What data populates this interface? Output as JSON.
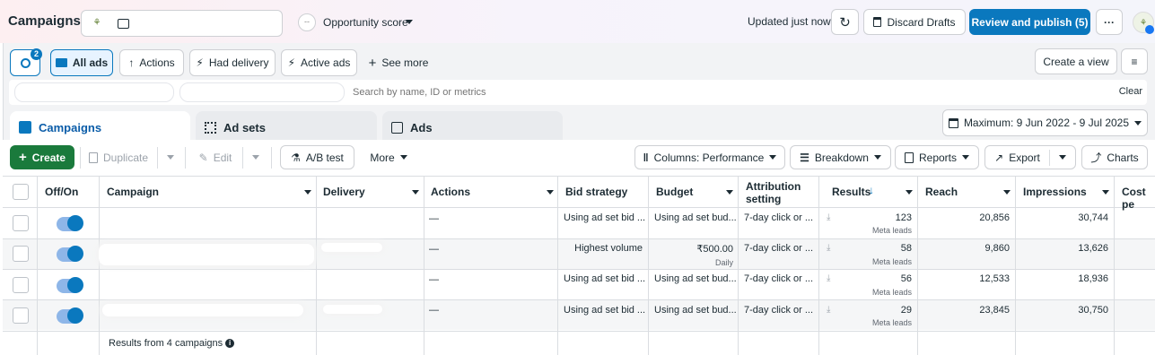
{
  "header": {
    "title": "Campaigns",
    "opportunity_label": "Opportunity score",
    "opportunity_dot": "--",
    "updated_text": "Updated just now",
    "discard_label": "Discard Drafts",
    "publish_label": "Review and publish (5)",
    "more_label": "···"
  },
  "filters": {
    "search_badge": "2",
    "items": [
      "All ads",
      "Actions",
      "Had delivery",
      "Active ads"
    ],
    "see_more": "See more",
    "create_view": "Create a view"
  },
  "search": {
    "placeholder": "Search by name, ID or metrics",
    "clear": "Clear"
  },
  "tabs": [
    "Campaigns",
    "Ad sets",
    "Ads"
  ],
  "date_range": "Maximum: 9 Jun 2022 - 9 Jul 2025",
  "toolbar": {
    "create": "Create",
    "duplicate": "Duplicate",
    "edit": "Edit",
    "ab_test": "A/B test",
    "more": "More",
    "columns": "Columns: Performance",
    "breakdown": "Breakdown",
    "reports": "Reports",
    "export": "Export",
    "charts": "Charts"
  },
  "table": {
    "headers": {
      "off_on": "Off/On",
      "campaign": "Campaign",
      "delivery": "Delivery",
      "actions": "Actions",
      "bid_strategy": "Bid strategy",
      "budget": "Budget",
      "attribution": "Attribution",
      "attribution2": "setting",
      "results": "Results",
      "reach": "Reach",
      "impressions": "Impressions",
      "cost": "Cost pe"
    },
    "rows": [
      {
        "actions": "—",
        "bid": "Using ad set bid ...",
        "budget": "Using ad set bud...",
        "budget_sub": "",
        "attribution": "7-day click or ...",
        "results": "123",
        "results_sub": "Meta leads",
        "reach": "20,856",
        "impressions": "30,744"
      },
      {
        "actions": "—",
        "bid": "Highest volume",
        "budget": "₹500.00",
        "budget_sub": "Daily",
        "attribution": "7-day click or ...",
        "results": "58",
        "results_sub": "Meta leads",
        "reach": "9,860",
        "impressions": "13,626"
      },
      {
        "actions": "—",
        "bid": "Using ad set bid ...",
        "budget": "Using ad set bud...",
        "budget_sub": "",
        "attribution": "7-day click or ...",
        "results": "56",
        "results_sub": "Meta leads",
        "reach": "12,533",
        "impressions": "18,936"
      },
      {
        "actions": "—",
        "bid": "Using ad set bid ...",
        "budget": "Using ad set bud...",
        "budget_sub": "",
        "attribution": "7-day click or ...",
        "results": "29",
        "results_sub": "Meta leads",
        "reach": "23,845",
        "impressions": "30,750"
      }
    ],
    "footer": "Results from 4 campaigns"
  }
}
